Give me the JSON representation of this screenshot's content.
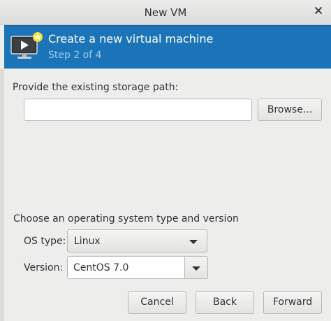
{
  "window": {
    "title": "New VM"
  },
  "banner": {
    "heading": "Create a new virtual machine",
    "step": "Step 2 of 4"
  },
  "storage": {
    "label": "Provide the existing storage path:",
    "path_value": "",
    "browse_label": "Browse..."
  },
  "os": {
    "section_label": "Choose an operating system type and version",
    "type_label": "OS type:",
    "type_value": "Linux",
    "version_label": "Version:",
    "version_value": "CentOS 7.0"
  },
  "buttons": {
    "cancel": "Cancel",
    "back": "Back",
    "forward": "Forward"
  },
  "icons": {
    "close": "close-icon",
    "vm": "new-vm-monitor-icon",
    "dropdown": "chevron-down-icon"
  },
  "colors": {
    "banner": "#1a74b7",
    "step_text": "#9ccaee"
  }
}
